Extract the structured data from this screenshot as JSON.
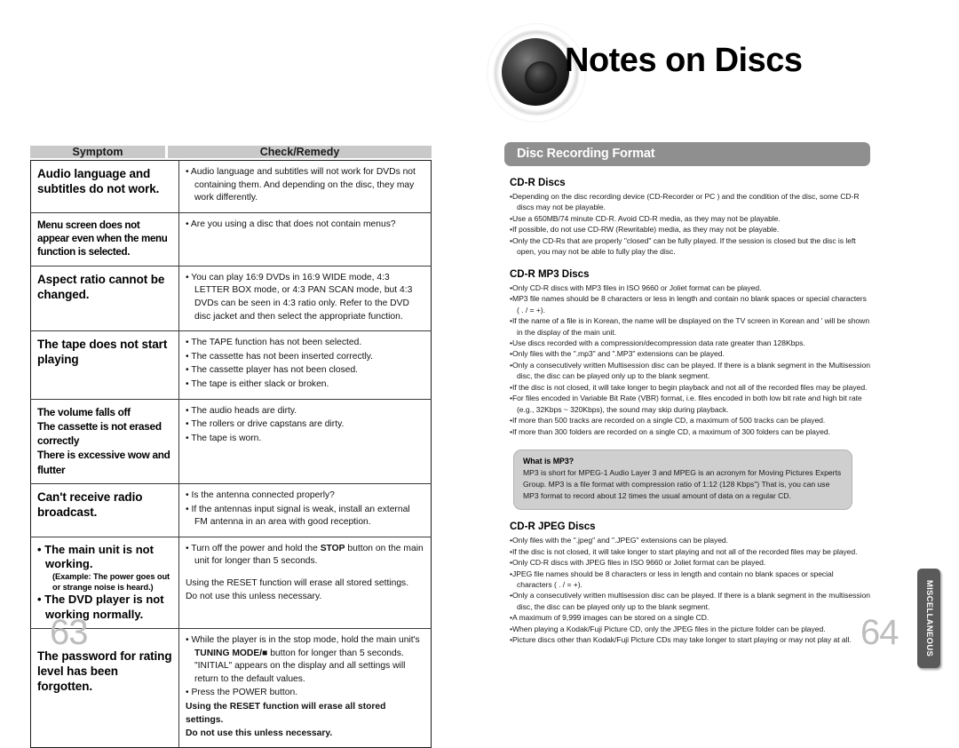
{
  "header": {
    "title": "Notes on Discs",
    "logo_name": "speaker-logo"
  },
  "troubleshoot_table": {
    "columns": [
      "Symptom",
      "Check/Remedy"
    ],
    "rows": [
      {
        "symptom": "Audio language and subtitles do not work.",
        "remedies": [
          "Audio language and subtitles will not work for DVDs not containing them. And depending on the disc, they may work differently."
        ]
      },
      {
        "symptom": "Menu screen does not appear even when the menu function is selected.",
        "remedies": [
          "Are you using a disc that does not contain menus?"
        ]
      },
      {
        "symptom": "Aspect ratio cannot be changed.",
        "remedies": [
          "You can play 16:9 DVDs in 16:9 WIDE mode, 4:3 LETTER BOX mode, or 4:3 PAN SCAN mode, but 4:3 DVDs can be seen in 4:3 ratio only. Refer to the DVD disc jacket and then select the appropriate function."
        ]
      },
      {
        "symptom": "The tape does not start playing",
        "remedies": [
          "The TAPE function has not been selected.",
          "The cassette has not been inserted correctly.",
          "The cassette player has not been closed.",
          "The tape is either slack or broken."
        ]
      },
      {
        "symptom_lines": [
          "The volume falls off",
          "The cassette is not erased correctly",
          "There is excessive wow and flutter"
        ],
        "remedies": [
          "The audio heads are dirty.",
          "The rollers or drive capstans are dirty.",
          "The tape is worn."
        ]
      },
      {
        "symptom": "Can't receive radio broadcast.",
        "remedies": [
          "Is the antenna connected properly?",
          "If the antennas input signal is weak, install an external FM antenna in an area with good reception."
        ]
      },
      {
        "symptom_bullets": [
          {
            "main": "The main unit is not working.",
            "sub": "(Example: The power goes out or strange noise is heard.)"
          },
          {
            "main": "The DVD player is not working normally.",
            "sub": ""
          }
        ],
        "remedy_bullet_pre": "Turn off the power and hold the ",
        "remedy_bullet_bold": "STOP",
        "remedy_bullet_post": " button on the main unit for longer than 5 seconds.",
        "remedy_note_1": "Using the RESET function will erase all stored settings.",
        "remedy_note_2": "Do not use this unless necessary."
      },
      {
        "symptom": "The password for rating level has been forgotten.",
        "remedy_line1_pre": "While the player is in the stop mode, hold the main unit's ",
        "remedy_line1_bold1": "TUNING MODE",
        "remedy_line1_mid": "/",
        "remedy_line1_bold2": "■",
        "remedy_line1_post": " button for longer than 5 seconds. \"INITIAL\" appears on the display and all settings will return to the default values.",
        "remedy_line2": "Press the POWER button.",
        "remedy_bold_1": "Using the RESET function will erase all stored settings.",
        "remedy_bold_2": "Do not use this unless necessary."
      }
    ]
  },
  "disc_recording": {
    "banner": "Disc Recording Format",
    "cdr": {
      "heading": "CD-R Discs",
      "items": [
        "Depending on the disc recording device (CD-Recorder or PC ) and the condition of the disc, some CD-R discs may not be playable.",
        "Use a 650MB/74 minute CD-R. Avoid CD-R media, as they may not be playable.",
        "If possible, do not use CD-RW (Rewritable) media, as they may not be playable.",
        "Only the CD-Rs that are properly \"closed\" can be fully played. If the session is closed but the disc is left open, you may not be able to fully play the disc."
      ]
    },
    "cdr_mp3": {
      "heading": "CD-R MP3 Discs",
      "items": [
        "Only CD-R discs with MP3 files in ISO 9660 or Joliet format can be played.",
        "MP3 file names should be 8 characters or less in length and contain no blank spaces or special characters ( . / = +).",
        "If the name of a file is in Korean, the name will be displayed on the TV screen in Korean and ' will be shown in the display of the main unit.",
        "Use discs recorded with a compression/decompression data rate greater than 128Kbps.",
        "Only files with the \".mp3\" and \".MP3\" extensions can be played.",
        "Only a consecutively written Multisession disc can be played. If there is a blank segment in the Multisession disc, the disc can be played only up to the blank segment.",
        "If the disc is not closed, it will take longer to begin playback and not all of the recorded files may be played.",
        "For files encoded in Variable Bit Rate (VBR) format, i.e. files encoded in both low bit rate and high bit rate (e.g., 32Kbps ~ 320Kbps), the sound may skip during playback.",
        "If more than 500 tracks are recorded on a single CD, a maximum of 500 tracks can be played.",
        "If more than 300 folders are recorded on a single CD, a maximum of 300 folders can be played."
      ]
    },
    "mp3_box": {
      "title": "What is MP3?",
      "text": "MP3 is short for MPEG-1 Audio Layer 3 and MPEG is an acronym for Moving Pictures Experts Group. MP3 is a file format with compression ratio of 1:12 (128 Kbps\") That is, you can use MP3 format to record about 12 times the usual amount of data on a regular CD."
    },
    "cdr_jpeg": {
      "heading": "CD-R JPEG Discs",
      "items": [
        "Only files with the \".jpeg\" and \".JPEG\" extensions can be played.",
        "If the disc is not closed, it will take longer to start playing and not all of the recorded files may be played.",
        "Only CD-R discs with JPEG files in ISO 9660 or Joliet format can be played.",
        "JPEG file names should be 8 characters or less in length and contain no blank spaces or special characters ( . / = +).",
        "Only a consecutively written multisession disc can be played. If there is a blank segment in the multisession disc, the disc can be played only up to the blank segment.",
        "A maximum of 9,999 images can be stored on a single CD.",
        "When playing a Kodak/Fuji Picture CD, only the JPEG files in the picture folder can be played.",
        "Picture discs other than Kodak/Fuji Picture CDs may take longer to start playing or may not play at all."
      ]
    }
  },
  "footer": {
    "page_left": "63",
    "page_right": "64",
    "side_tab": "MISCELLANEOUS"
  },
  "colors": {
    "banner_gray": "#8f8f8f",
    "table_header_gray": "#c9c9c9",
    "mp3_box_gray": "#cfcfcf",
    "side_tab_dark": "#5a5a5a",
    "page_number_gray": "#bdbdbd"
  }
}
